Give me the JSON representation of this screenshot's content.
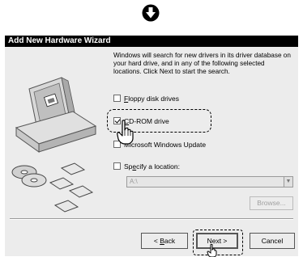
{
  "step_indicator": {
    "icon": "down-arrow-circle-icon"
  },
  "window": {
    "title": "Add New Hardware Wizard"
  },
  "description": "Windows will search for new drivers in its driver database on your hard drive, and in any of the following selected locations. Click Next to start the search.",
  "options": {
    "floppy": {
      "accel": "F",
      "rest": "loppy disk drives",
      "checked": false
    },
    "cdrom": {
      "accel": "C",
      "rest": "D-ROM drive",
      "checked": true
    },
    "update": {
      "text": "Microsoft Windows Update",
      "checked": false
    },
    "location": {
      "accel": "e",
      "pre": "Sp",
      "rest": "cify a location:",
      "checked": false
    }
  },
  "location_field": {
    "value": "A:\\"
  },
  "browse_button": {
    "label": "Browse..."
  },
  "nav": {
    "back": {
      "pre": "< ",
      "accel": "B",
      "rest": "ack"
    },
    "next": {
      "label": "Next >"
    },
    "cancel": {
      "label": "Cancel"
    }
  }
}
